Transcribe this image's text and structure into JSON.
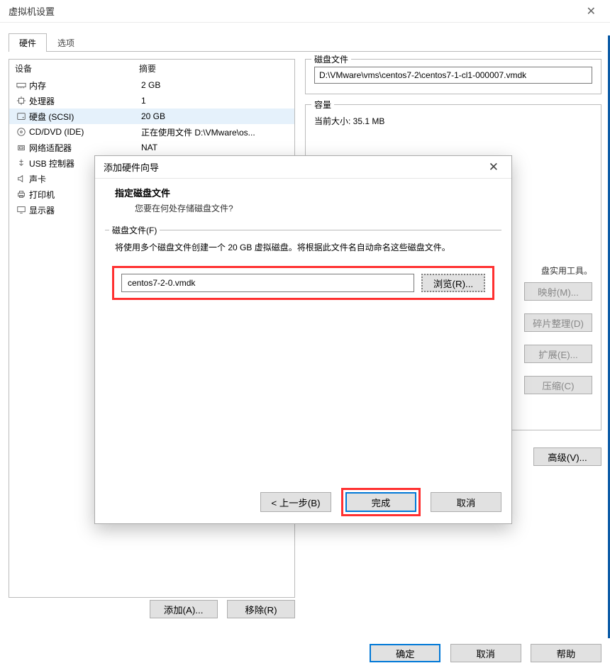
{
  "outer": {
    "title": "虚拟机设置",
    "tabs": {
      "hardware": "硬件",
      "options": "选项"
    },
    "headers": {
      "device": "设备",
      "summary": "摘要"
    },
    "devices": [
      {
        "name": "内存",
        "summary": "2 GB",
        "icon": "memory"
      },
      {
        "name": "处理器",
        "summary": "1",
        "icon": "cpu"
      },
      {
        "name": "硬盘 (SCSI)",
        "summary": "20 GB",
        "icon": "disk",
        "selected": true
      },
      {
        "name": "CD/DVD (IDE)",
        "summary": "正在使用文件 D:\\VMware\\os...",
        "icon": "cd"
      },
      {
        "name": "网络适配器",
        "summary": "NAT",
        "icon": "net"
      },
      {
        "name": "USB 控制器",
        "summary": "",
        "icon": "usb"
      },
      {
        "name": "声卡",
        "summary": "",
        "icon": "sound"
      },
      {
        "name": "打印机",
        "summary": "",
        "icon": "printer"
      },
      {
        "name": "显示器",
        "summary": "",
        "icon": "display"
      }
    ],
    "diskfile_label": "磁盘文件",
    "diskfile_value": "D:\\VMware\\vms\\centos7-2\\centos7-1-cl1-000007.vmdk",
    "capacity_label": "容量",
    "capacity_current": "当前大小: 35.1 MB",
    "util_hint_tail": "盘实用工具。",
    "btn_map": "映射(M)...",
    "btn_defrag": "碎片整理(D)",
    "btn_expand": "扩展(E)...",
    "btn_compress": "压缩(C)",
    "btn_advanced": "高级(V)...",
    "btn_add": "添加(A)...",
    "btn_remove": "移除(R)",
    "btn_ok": "确定",
    "btn_cancel": "取消",
    "btn_help": "帮助"
  },
  "wizard": {
    "title": "添加硬件向导",
    "heading": "指定磁盘文件",
    "subheading": "您要在何处存储磁盘文件?",
    "group_label": "磁盘文件(F)",
    "desc": "将使用多个磁盘文件创建一个 20 GB 虚拟磁盘。将根据此文件名自动命名这些磁盘文件。",
    "file_value": "centos7-2-0.vmdk",
    "browse": "浏览(R)...",
    "back": "< 上一步(B)",
    "finish": "完成",
    "cancel": "取消"
  }
}
